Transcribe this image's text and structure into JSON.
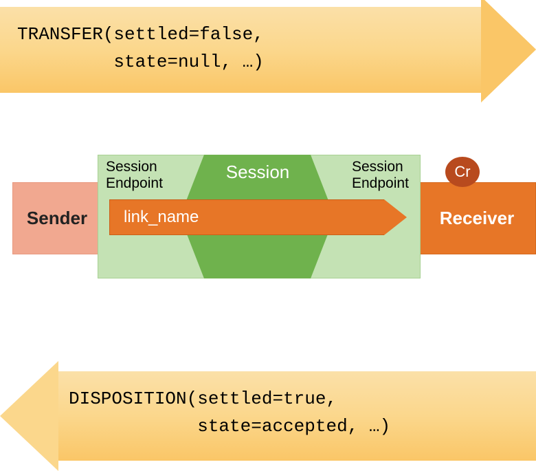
{
  "transfer": {
    "text": "TRANSFER(settled=false,\n         state=null, …)"
  },
  "disposition": {
    "text": "DISPOSITION(settled=true,\n            state=accepted, …)"
  },
  "sender": {
    "label": "Sender"
  },
  "receiver": {
    "label": "Receiver"
  },
  "session": {
    "title": "Session",
    "endpoint_left_l1": "Session",
    "endpoint_left_l2": "Endpoint",
    "endpoint_right_l1": "Session",
    "endpoint_right_l2": "Endpoint"
  },
  "link": {
    "label": "link_name"
  },
  "badge": {
    "label": "Cr"
  }
}
